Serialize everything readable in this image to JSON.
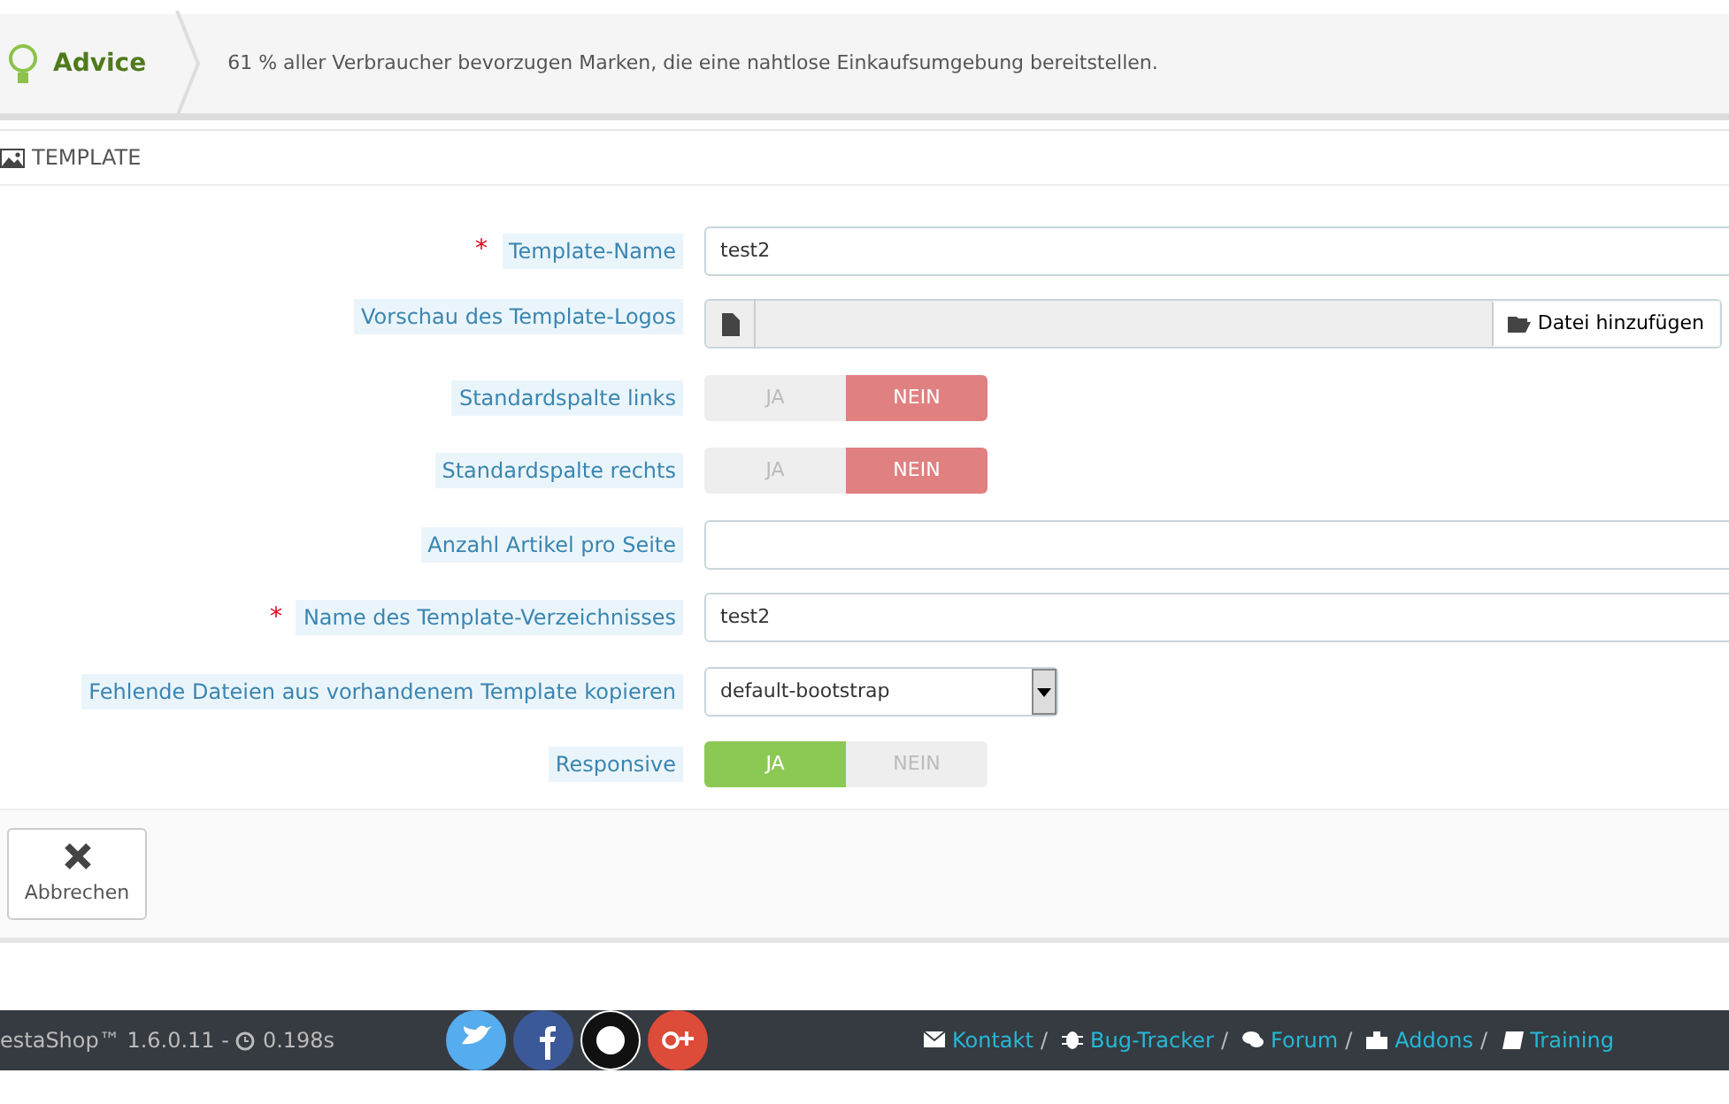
{
  "advice": {
    "title": "Advice",
    "message": "61 % aller Verbraucher bevorzugen Marken, die eine nahtlose Einkaufsumgebung bereitstellen."
  },
  "panel": {
    "title": "TEMPLATE"
  },
  "fields": [
    {
      "kind": "text",
      "required_mark": "*",
      "label": "Template-Name",
      "value": "test2"
    },
    {
      "kind": "file",
      "label": "Vorschau des Template-Logos",
      "button": "Datei hinzufügen"
    },
    {
      "kind": "switch",
      "label": "Standardspalte links",
      "on": false,
      "yes": "JA",
      "no": "NEIN"
    },
    {
      "kind": "switch",
      "label": "Standardspalte rechts",
      "on": false,
      "yes": "JA",
      "no": "NEIN"
    },
    {
      "kind": "text",
      "label": "Anzahl Artikel pro Seite"
    },
    {
      "kind": "text",
      "required_mark": "*",
      "label": "Name des Template-Verzeichnisses",
      "value": "test2"
    },
    {
      "kind": "select",
      "label": "Fehlende Dateien aus vorhandenem Template kopieren",
      "value": "default-bootstrap"
    },
    {
      "kind": "switch",
      "label": "Responsive",
      "on": true,
      "yes": "JA",
      "no": "NEIN"
    }
  ],
  "cancel_button": "Abbrechen",
  "footer": {
    "version": "estaShop™ 1.6.0.11 -",
    "time": "0.198s",
    "links": [
      {
        "kind": "mail",
        "label": "Kontakt"
      },
      {
        "kind": "bug",
        "label": "Bug-Tracker"
      },
      {
        "kind": "chat",
        "label": "Forum"
      },
      {
        "kind": "puzzle",
        "label": "Addons"
      },
      {
        "kind": "book",
        "label": "Training"
      }
    ],
    "separator": "/"
  }
}
